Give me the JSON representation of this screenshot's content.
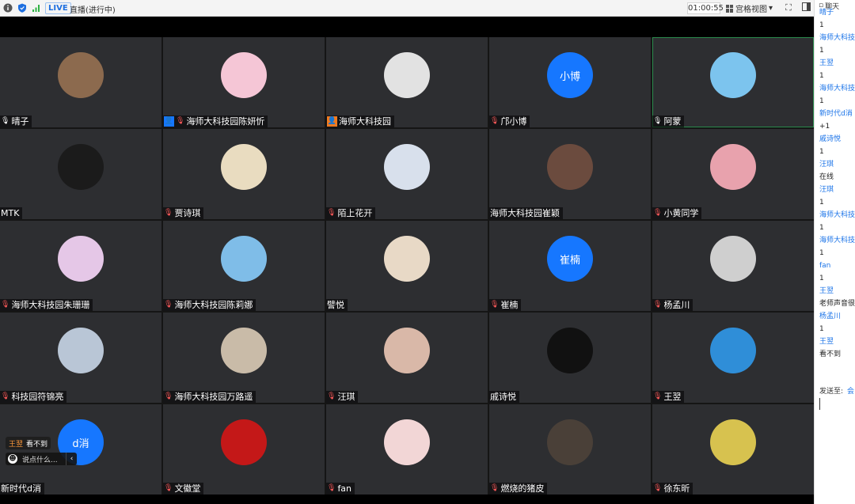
{
  "topbar": {
    "live_label": "LIVE",
    "status": "直播(进行中)",
    "timer": "01:00:55",
    "view_mode": "宫格视图",
    "view_caret": "▾"
  },
  "tiles": [
    {
      "name": "晴子",
      "avatar_text": "",
      "color": "#8c6a4e"
    },
    {
      "name": "海师大科技园陈妍忻",
      "avatar_text": "",
      "color": "#f5c6d6"
    },
    {
      "name": "海师大科技园",
      "avatar_text": "",
      "color": "#e2e2e2"
    },
    {
      "name": "邝小博",
      "avatar_text": "小博",
      "color": "#1677ff"
    },
    {
      "name": "阿蒙",
      "avatar_text": "",
      "color": "#7cc4ee"
    },
    {
      "name": "MTK",
      "avatar_text": "",
      "color": "#1b1b1b"
    },
    {
      "name": "贾诗琪",
      "avatar_text": "",
      "color": "#e9dcc0"
    },
    {
      "name": "陌上花开",
      "avatar_text": "",
      "color": "#d8e0ec"
    },
    {
      "name": "海师大科技园崔颖",
      "avatar_text": "",
      "color": "#6b4b3e"
    },
    {
      "name": "小黄同学",
      "avatar_text": "",
      "color": "#e8a2ad"
    },
    {
      "name": "海师大科技园朱珊珊",
      "avatar_text": "",
      "color": "#e5c7e7"
    },
    {
      "name": "海师大科技园陈莉娜",
      "avatar_text": "",
      "color": "#7fbde8"
    },
    {
      "name": "譬悦",
      "avatar_text": "",
      "color": "#e8d9c6"
    },
    {
      "name": "崔楠",
      "avatar_text": "崔楠",
      "color": "#1677ff"
    },
    {
      "name": "杨孟川",
      "avatar_text": "",
      "color": "#cfcfcf"
    },
    {
      "name": "科技园符锦亮",
      "avatar_text": "",
      "color": "#b9c6d6"
    },
    {
      "name": "海师大科技园万路遥",
      "avatar_text": "",
      "color": "#c9bba8"
    },
    {
      "name": "汪琪",
      "avatar_text": "",
      "color": "#d9b8a8"
    },
    {
      "name": "戚诗悦",
      "avatar_text": "",
      "color": "#111111"
    },
    {
      "name": "王翌",
      "avatar_text": "",
      "color": "#2f8ed8"
    },
    {
      "name": "新时代d消",
      "avatar_text": "d消",
      "color": "#1677ff"
    },
    {
      "name": "文徽堂",
      "avatar_text": "",
      "color": "#c41818"
    },
    {
      "name": "fan",
      "avatar_text": "",
      "color": "#f2d6d6"
    },
    {
      "name": "燃烧的猪皮",
      "avatar_text": "",
      "color": "#4a4038"
    },
    {
      "name": "徐东昕",
      "avatar_text": "",
      "color": "#d7c24f"
    }
  ],
  "chat": {
    "title": "聊天",
    "messages": [
      {
        "text": "晴子",
        "kind": "user"
      },
      {
        "text": "1",
        "kind": "msg"
      },
      {
        "text": "海师大科技园陈妍忻",
        "kind": "user"
      },
      {
        "text": "1",
        "kind": "msg"
      },
      {
        "text": "王翌",
        "kind": "user"
      },
      {
        "text": "1",
        "kind": "msg"
      },
      {
        "text": "海师大科技园崔颖",
        "kind": "user"
      },
      {
        "text": "1",
        "kind": "msg"
      },
      {
        "text": "新时代d消",
        "kind": "user"
      },
      {
        "text": "+1",
        "kind": "msg"
      },
      {
        "text": "戚诗悦",
        "kind": "user"
      },
      {
        "text": "1",
        "kind": "msg"
      },
      {
        "text": "汪琪",
        "kind": "user"
      },
      {
        "text": "在线",
        "kind": "msg"
      },
      {
        "text": "汪琪",
        "kind": "user"
      },
      {
        "text": "1",
        "kind": "msg"
      },
      {
        "text": "海师大科技园朱珊珊",
        "kind": "user"
      },
      {
        "text": "1",
        "kind": "msg"
      },
      {
        "text": "海师大科技园陈莉娜",
        "kind": "user"
      },
      {
        "text": "1",
        "kind": "msg"
      },
      {
        "text": "fan",
        "kind": "user"
      },
      {
        "text": "1",
        "kind": "msg"
      },
      {
        "text": "王翌",
        "kind": "user"
      },
      {
        "text": "老师声音很小",
        "kind": "msg"
      },
      {
        "text": "杨孟川",
        "kind": "user"
      },
      {
        "text": "1",
        "kind": "msg"
      },
      {
        "text": "王翌",
        "kind": "user"
      },
      {
        "text": "看不到",
        "kind": "msg"
      }
    ],
    "send_to_label": "发送至:",
    "send_to_value": "会"
  },
  "toast": {
    "name": "王翌",
    "message": "看不到"
  },
  "input": {
    "placeholder": "说点什么..."
  }
}
